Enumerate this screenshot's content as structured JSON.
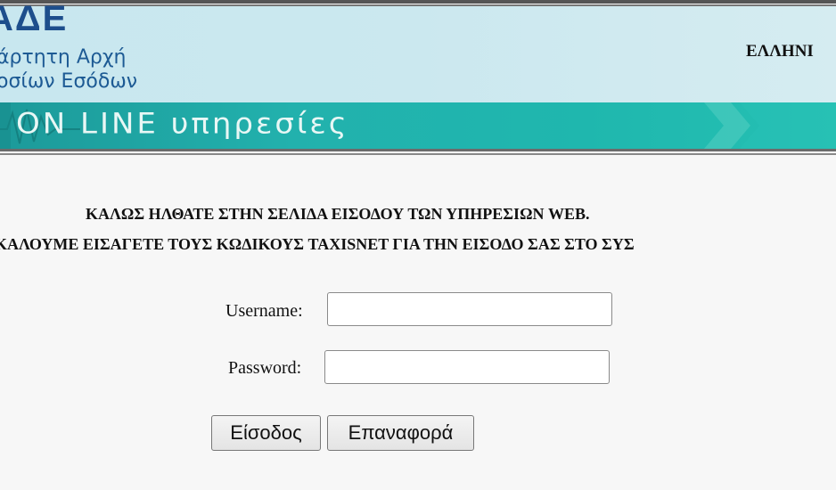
{
  "header": {
    "logo_abbr": "ΑΔΕ",
    "logo_line1": "άρτητη Αρχή",
    "logo_line2": "οσίων Εσόδων",
    "country": "ΕΛΛΗΝΙ",
    "banner_text": "ON LINE υπηρεσίες",
    "colors": {
      "banner_bg": "#c8e7ef",
      "band": "#1fb1ad",
      "logo_text": "#1d4e8c"
    }
  },
  "welcome": {
    "line1": "ΚΑΛΩΣ ΗΛΘΑΤΕ ΣΤΗΝ ΣΕΛΙΔΑ ΕΙΣΟΔΟΥ ΤΩΝ ΥΠΗΡΕΣΙΩΝ WEB.",
    "line2": "ΚΑΛΟΥΜΕ ΕΙΣΑΓΕΤΕ ΤΟΥΣ ΚΩΔΙΚΟΥΣ TAXISNET ΓΙΑ ΤΗΝ ΕΙΣΟΔΟ ΣΑΣ ΣΤΟ ΣΥΣ"
  },
  "form": {
    "username_label": "Username:",
    "username_value": "",
    "password_label": "Password:",
    "password_value": "",
    "login_button": "Είσοδος",
    "reset_button": "Επαναφορά"
  }
}
